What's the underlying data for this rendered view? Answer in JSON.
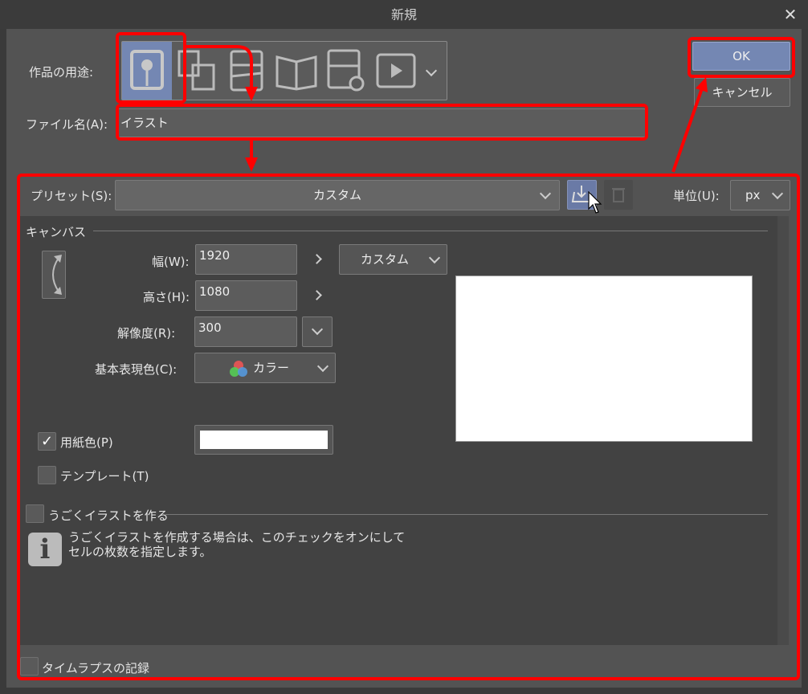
{
  "window": {
    "title": "新規"
  },
  "usage": {
    "label": "作品の用途:",
    "icons": [
      "illustration-icon",
      "comic-icon",
      "webtoon-icon",
      "book-icon",
      "comic-settings-icon",
      "animation-icon"
    ],
    "selected": 0
  },
  "filename": {
    "label": "ファイル名(A):",
    "value": "イラスト"
  },
  "buttons": {
    "ok": "OK",
    "cancel": "キャンセル"
  },
  "preset": {
    "label": "プリセット(S):",
    "value": "カスタム"
  },
  "unit": {
    "label": "単位(U):",
    "value": "px"
  },
  "canvas": {
    "section": "キャンバス",
    "width_label": "幅(W):",
    "width": "1920",
    "height_label": "高さ(H):",
    "height": "1080",
    "size_preset": "カスタム",
    "resolution_label": "解像度(R):",
    "resolution": "300",
    "color_label": "基本表現色(C):",
    "color": "カラー",
    "paper_label": "用紙色(P)",
    "paper_checked": true,
    "paper_color": "#ffffff",
    "template_label": "テンプレート(T)",
    "template_checked": false
  },
  "animation": {
    "label": "うごくイラストを作る",
    "checked": false,
    "info_line1": "うごくイラストを作成する場合は、このチェックをオンにして",
    "info_line2": "セルの枚数を指定します。"
  },
  "timelapse": {
    "label": "タイムラプスの記録",
    "checked": false
  },
  "colors": {
    "accent": "#7487b3",
    "annotation": "#ff0000"
  }
}
